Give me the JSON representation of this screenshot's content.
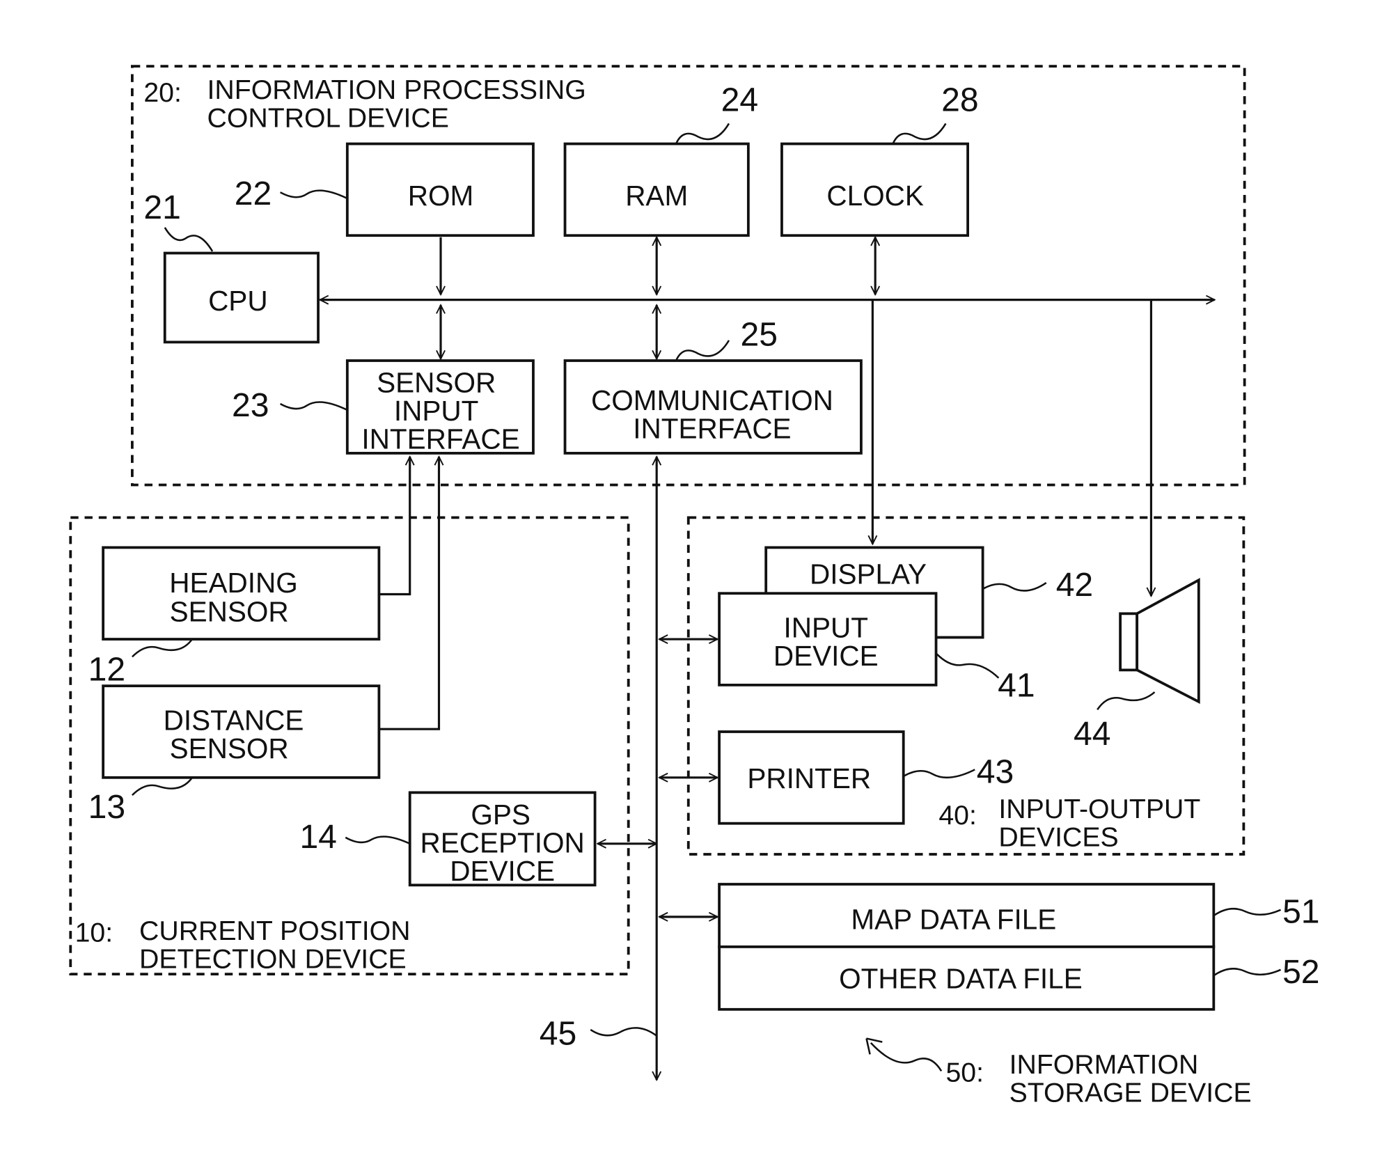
{
  "diagram": {
    "groups": {
      "info_processing": {
        "ref": "20",
        "line1": "INFORMATION PROCESSING",
        "line2": "CONTROL DEVICE"
      },
      "current_position": {
        "ref": "10",
        "line1": "CURRENT POSITION",
        "line2": "DETECTION DEVICE"
      },
      "input_output": {
        "ref": "40",
        "line1": "INPUT-OUTPUT",
        "line2": "DEVICES"
      },
      "storage": {
        "ref": "50",
        "line1": "INFORMATION",
        "line2": "STORAGE DEVICE"
      }
    },
    "blocks": {
      "cpu": {
        "ref": "21",
        "label": "CPU"
      },
      "rom": {
        "ref": "22",
        "label": "ROM"
      },
      "ram": {
        "ref": "24",
        "label": "RAM"
      },
      "clock": {
        "ref": "28",
        "label": "CLOCK"
      },
      "sensor_if": {
        "ref": "23",
        "l1": "SENSOR",
        "l2": "INPUT",
        "l3": "INTERFACE"
      },
      "comm_if": {
        "ref": "25",
        "l1": "COMMUNICATION",
        "l2": "INTERFACE"
      },
      "heading": {
        "ref": "12",
        "l1": "HEADING",
        "l2": "SENSOR"
      },
      "distance": {
        "ref": "13",
        "l1": "DISTANCE",
        "l2": "SENSOR"
      },
      "gps": {
        "ref": "14",
        "l1": "GPS",
        "l2": "RECEPTION",
        "l3": "DEVICE"
      },
      "display": {
        "ref": "42",
        "label": "DISPLAY"
      },
      "input": {
        "ref": "41",
        "l1": "INPUT",
        "l2": "DEVICE"
      },
      "printer": {
        "ref": "43",
        "label": "PRINTER"
      },
      "speaker": {
        "ref": "44"
      },
      "map_file": {
        "ref": "51",
        "label": "MAP DATA FILE"
      },
      "other_file": {
        "ref": "52",
        "label": "OTHER DATA FILE"
      },
      "bus": {
        "ref": "45"
      }
    }
  }
}
